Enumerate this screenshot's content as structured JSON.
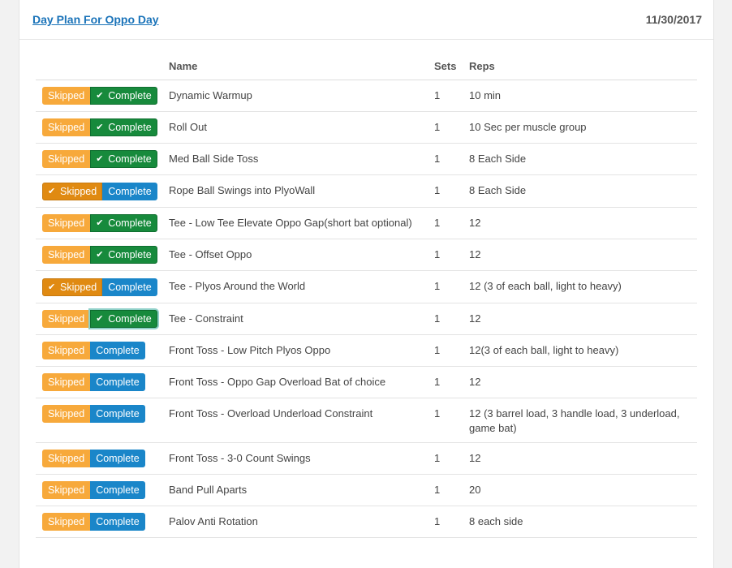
{
  "header": {
    "title": "Day Plan For Oppo Day",
    "date": "11/30/2017"
  },
  "table": {
    "columns": {
      "name": "Name",
      "sets": "Sets",
      "reps": "Reps"
    },
    "rows": [
      {
        "skip_label": "Skipped",
        "complete_label": "Complete",
        "state": "complete",
        "name": "Dynamic Warmup",
        "sets": "1",
        "reps": "10 min"
      },
      {
        "skip_label": "Skipped",
        "complete_label": "Complete",
        "state": "complete",
        "name": "Roll Out",
        "sets": "1",
        "reps": "10 Sec per muscle group"
      },
      {
        "skip_label": "Skipped",
        "complete_label": "Complete",
        "state": "complete",
        "name": "Med Ball Side Toss",
        "sets": "1",
        "reps": "8 Each Side"
      },
      {
        "skip_label": "Skipped",
        "complete_label": "Complete",
        "state": "skipped",
        "name": "Rope Ball Swings into PlyoWall",
        "sets": "1",
        "reps": "8 Each Side"
      },
      {
        "skip_label": "Skipped",
        "complete_label": "Complete",
        "state": "complete",
        "name": "Tee - Low Tee Elevate Oppo Gap(short bat optional)",
        "sets": "1",
        "reps": "12"
      },
      {
        "skip_label": "Skipped",
        "complete_label": "Complete",
        "state": "complete",
        "name": "Tee - Offset Oppo",
        "sets": "1",
        "reps": "12"
      },
      {
        "skip_label": "Skipped",
        "complete_label": "Complete",
        "state": "skipped",
        "name": "Tee - Plyos Around the World",
        "sets": "1",
        "reps": "12 (3 of each ball, light to heavy)"
      },
      {
        "skip_label": "Skipped",
        "complete_label": "Complete",
        "state": "complete",
        "focused": true,
        "name": "Tee - Constraint",
        "sets": "1",
        "reps": "12"
      },
      {
        "skip_label": "Skipped",
        "complete_label": "Complete",
        "state": "none",
        "name": "Front Toss - Low Pitch Plyos Oppo",
        "sets": "1",
        "reps": "12(3 of each ball, light to heavy)"
      },
      {
        "skip_label": "Skipped",
        "complete_label": "Complete",
        "state": "none",
        "name": "Front Toss - Oppo Gap Overload Bat of choice",
        "sets": "1",
        "reps": "12"
      },
      {
        "skip_label": "Skipped",
        "complete_label": "Complete",
        "state": "none",
        "name": "Front Toss - Overload Underload Constraint",
        "sets": "1",
        "reps": "12 (3 barrel load, 3 handle load, 3 underload, game bat)"
      },
      {
        "skip_label": "Skipped",
        "complete_label": "Complete",
        "state": "none",
        "name": "Front Toss - 3-0 Count Swings",
        "sets": "1",
        "reps": "12"
      },
      {
        "skip_label": "Skipped",
        "complete_label": "Complete",
        "state": "none",
        "name": "Band Pull Aparts",
        "sets": "1",
        "reps": "20"
      },
      {
        "skip_label": "Skipped",
        "complete_label": "Complete",
        "state": "none",
        "name": "Palov Anti Rotation",
        "sets": "1",
        "reps": "8 each side"
      }
    ]
  },
  "icons": {
    "check": "check-icon"
  },
  "colors": {
    "skip": "#f7a93b",
    "skip_active": "#e08a12",
    "complete": "#1a86c9",
    "complete_active": "#178a3c",
    "link": "#1a73b9"
  }
}
